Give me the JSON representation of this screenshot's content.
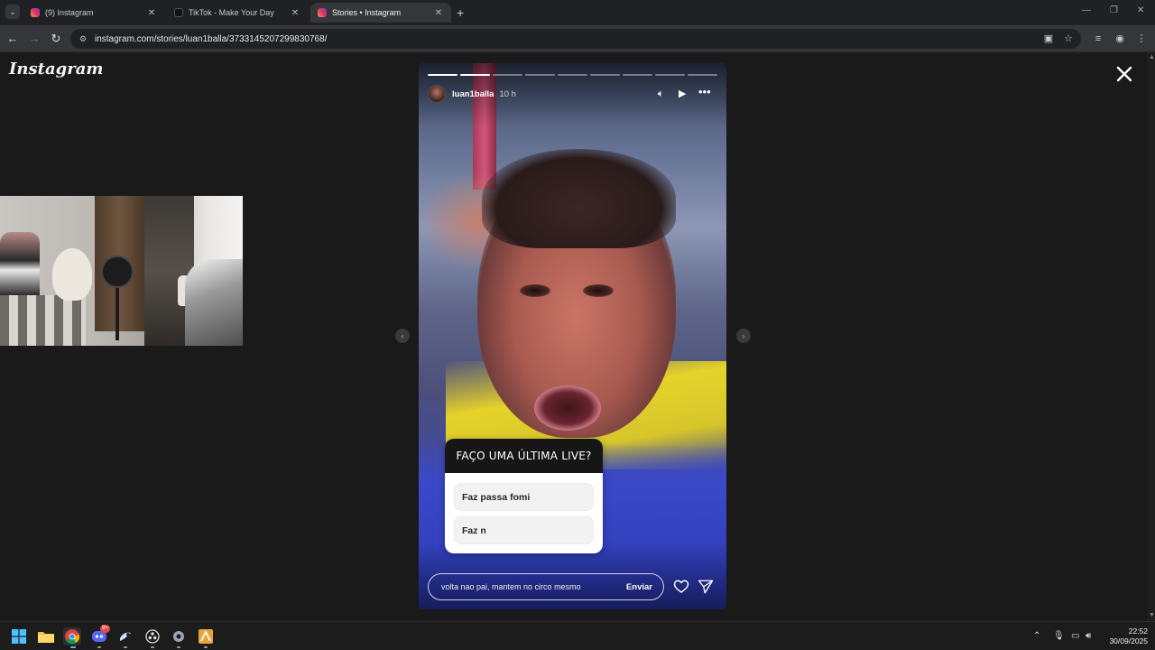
{
  "browser": {
    "tabs": [
      {
        "title": "(9) Instagram",
        "active": false
      },
      {
        "title": "TikTok - Make Your Day",
        "active": false
      },
      {
        "title": "Stories • Instagram",
        "active": true
      }
    ],
    "address": "instagram.com/stories/luan1balla/3733145207299830768/"
  },
  "page": {
    "logo": "Instagram"
  },
  "story": {
    "username": "luan1balla",
    "time_ago": "10 h",
    "segments_total": 9,
    "segments_done": 2,
    "poll": {
      "question": "FAÇO UMA ÚLTIMA LIVE?",
      "options": [
        "Faz passa fomi",
        "Faz n"
      ]
    },
    "reply": {
      "text": "volta nao pai, mantem no circo mesmo",
      "send_label": "Enviar"
    }
  },
  "taskbar": {
    "discord_badge": "9+",
    "time": "22:52",
    "date": "30/09/2025"
  },
  "colors": {
    "page_bg": "#1a1a1a",
    "chrome_bg": "#35363a",
    "tabstrip_bg": "#202124"
  }
}
